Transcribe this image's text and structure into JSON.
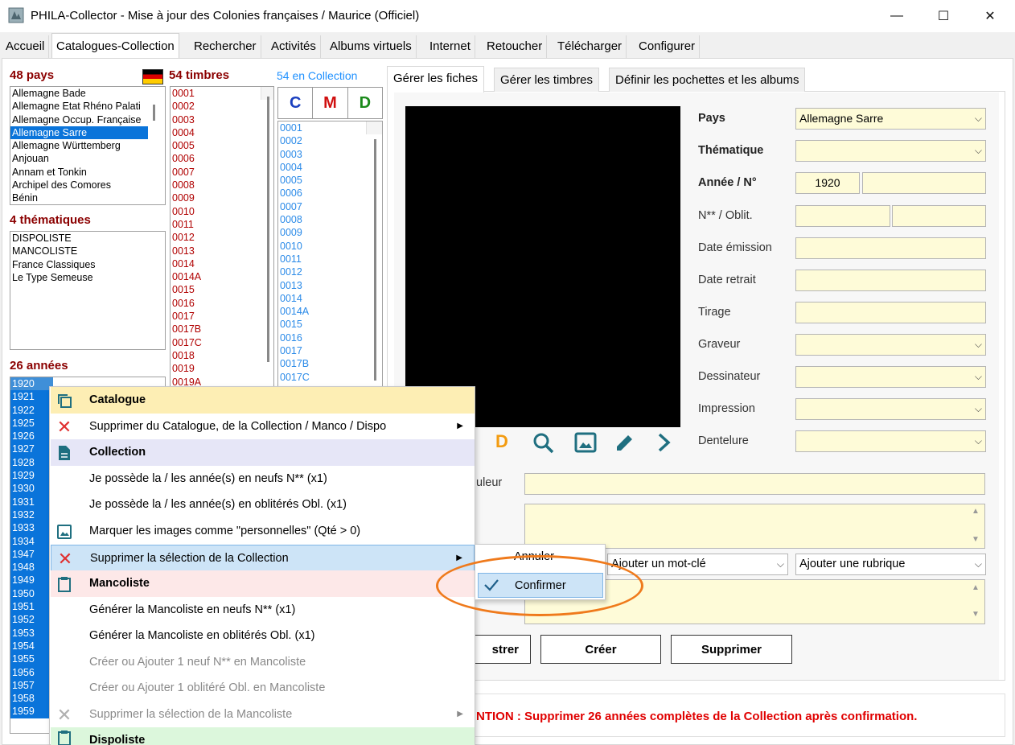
{
  "window": {
    "title": "PHILA-Collector - Mise à jour des Colonies françaises / Maurice (Officiel)",
    "minimize": "—",
    "maximize": "☐",
    "close": "✕"
  },
  "tabs": [
    "Accueil",
    "Catalogues-Collection",
    "Rechercher",
    "Activités",
    "Albums virtuels",
    "Internet",
    "Retoucher",
    "Télécharger",
    "Configurer"
  ],
  "countries": {
    "header": "48 pays",
    "items": [
      "Allemagne Bade",
      "Allemagne Etat Rhéno Palati",
      "Allemagne Occup. Française",
      "Allemagne Sarre",
      "Allemagne Württemberg",
      "Anjouan",
      "Annam et Tonkin",
      "Archipel des Comores",
      "Bénin"
    ],
    "selected": "Allemagne Sarre"
  },
  "themes": {
    "header": "4 thématiques",
    "items": [
      "DISPOLISTE",
      "MANCOLISTE",
      "France Classiques",
      "Le Type Semeuse"
    ]
  },
  "years": {
    "header": "26 années",
    "items": [
      "1920",
      "1921",
      "1922",
      "1925",
      "1926",
      "1927",
      "1928",
      "1929",
      "1930",
      "1931",
      "1932",
      "1933",
      "1934",
      "1947",
      "1948",
      "1949",
      "1950",
      "1951",
      "1952",
      "1953",
      "1954",
      "1955",
      "1956",
      "1957",
      "1958",
      "1959"
    ]
  },
  "stamps": {
    "header": "54 timbres",
    "items": [
      "0001",
      "0002",
      "0003",
      "0004",
      "0005",
      "0006",
      "0007",
      "0008",
      "0009",
      "0010",
      "0011",
      "0012",
      "0013",
      "0014",
      "0014A",
      "0015",
      "0016",
      "0017",
      "0017B",
      "0017C",
      "0018",
      "0019",
      "0019A"
    ]
  },
  "collection": {
    "header": "54 en Collection",
    "btn_c": "C",
    "btn_m": "M",
    "btn_d": "D",
    "items": [
      "0001",
      "0002",
      "0003",
      "0004",
      "0005",
      "0006",
      "0007",
      "0008",
      "0009",
      "0010",
      "0011",
      "0012",
      "0013",
      "0014",
      "0014A",
      "0015",
      "0016",
      "0017",
      "0017B",
      "0017C"
    ]
  },
  "subtabs": [
    "Gérer les fiches",
    "Gérer les timbres",
    "Définir les pochettes et les albums"
  ],
  "form": {
    "pays_label": "Pays",
    "pays_value": "Allemagne Sarre",
    "thematique_label": "Thématique",
    "annee_label": "Année / N°",
    "annee_value": "1920",
    "neuf_label": "N** / Oblit.",
    "emission_label": "Date émission",
    "retrait_label": "Date retrait",
    "tirage_label": "Tirage",
    "graveur_label": "Graveur",
    "dessinateur_label": "Dessinateur",
    "impression_label": "Impression",
    "dentelure_label": "Dentelure",
    "couleur_label": "uleur",
    "motcle_placeholder": "Ajouter un mot-clé",
    "rubrique_placeholder": "Ajouter une rubrique"
  },
  "icons": {
    "d_letter": "D"
  },
  "buttons": {
    "enregistrer": "strer",
    "creer": "Créer",
    "supprimer": "Supprimer"
  },
  "warning": "NTION : Supprimer 26 années complètes de la Collection après confirmation.",
  "menu": {
    "catalogue": "Catalogue",
    "supprimer_catalogue": "Supprimer du Catalogue, de la Collection / Manco / Dispo",
    "collection": "Collection",
    "neufs": "Je possède la / les année(s) en neufs N** (x1)",
    "obliteres": "Je possède la / les année(s) en oblitérés Obl. (x1)",
    "personnelles": "Marquer les images comme \"personnelles\" (Qté > 0)",
    "supprimer_collection": "Supprimer la sélection de la Collection",
    "mancoliste": "Mancoliste",
    "gen_neufs": "Générer la Mancoliste en neufs N** (x1)",
    "gen_obl": "Générer la Mancoliste en oblitérés Obl. (x1)",
    "creer_neuf": "Créer ou Ajouter 1 neuf N** en Mancoliste",
    "creer_obl": "Créer ou Ajouter 1 oblitéré Obl. en Mancoliste",
    "supprimer_manco": "Supprimer la sélection de la Mancoliste",
    "dispoliste": "Dispoliste"
  },
  "submenu": {
    "annuler": "Annuler",
    "confirmer": "Confirmer"
  },
  "colors": {
    "accent_orange": "#ef7a1c",
    "selection_blue": "#0a74da",
    "field_yellow": "#fefbd8",
    "dark_red": "#8b0000"
  }
}
